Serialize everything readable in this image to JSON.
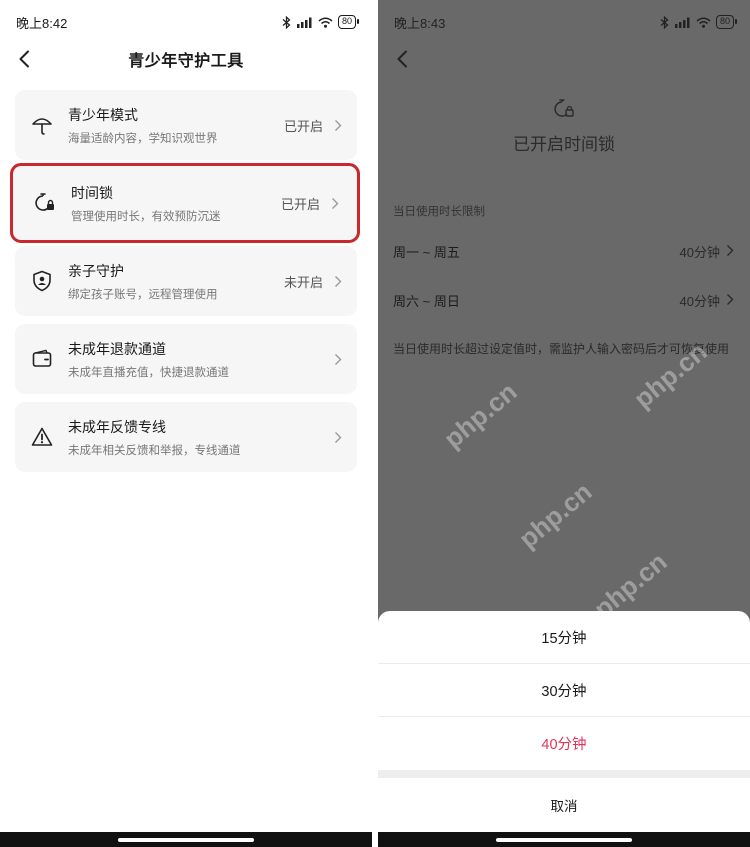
{
  "left": {
    "status_time": "晚上8:42",
    "battery": "80",
    "nav_title": "青少年守护工具",
    "items": [
      {
        "title": "青少年模式",
        "subtitle": "海量适龄内容，学知识观世界",
        "status": "已开启"
      },
      {
        "title": "时间锁",
        "subtitle": "管理使用时长，有效预防沉迷",
        "status": "已开启"
      },
      {
        "title": "亲子守护",
        "subtitle": "绑定孩子账号，远程管理使用",
        "status": "未开启"
      },
      {
        "title": "未成年退款通道",
        "subtitle": "未成年直播充值，快捷退款通道",
        "status": ""
      },
      {
        "title": "未成年反馈专线",
        "subtitle": "未成年相关反馈和举报，专线通道",
        "status": ""
      }
    ]
  },
  "right": {
    "status_time": "晚上8:43",
    "battery": "80",
    "lock_title": "已开启时间锁",
    "section_label": "当日使用时长限制",
    "rows": [
      {
        "label": "周一 ~ 周五",
        "value": "40分钟"
      },
      {
        "label": "周六 ~ 周日",
        "value": "40分钟"
      }
    ],
    "note": "当日使用时长超过设定值时，需监护人输入密码后才可恢复使用",
    "sheet": {
      "options": [
        "15分钟",
        "30分钟",
        "40分钟"
      ],
      "selected_index": 2,
      "cancel": "取消"
    }
  },
  "watermark": "php.cn",
  "colors": {
    "highlight_border": "#c9282d",
    "selected_option": "#e0325a",
    "overlay_bg": "#696969"
  }
}
